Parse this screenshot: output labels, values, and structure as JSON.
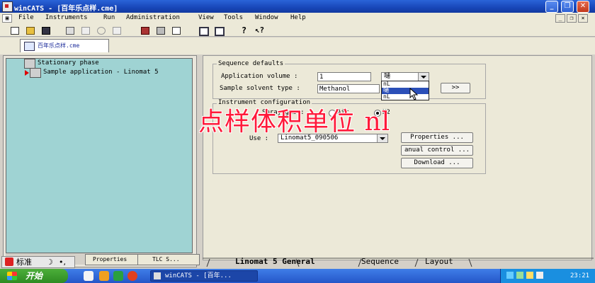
{
  "window": {
    "title": "winCATS - [百年乐点样.cme]",
    "minimize": "_",
    "restore": "❐",
    "close": "✕"
  },
  "menu": [
    "File",
    "Instruments",
    "Run",
    "Administration",
    "View",
    "Tools",
    "Window",
    "Help"
  ],
  "toolbar": {
    "icons": [
      "new-icon",
      "open-icon",
      "save-icon",
      "copy-doc-icon",
      "paste-doc-icon",
      "refresh-icon",
      "report-icon",
      "instrument-icon",
      "print-icon",
      "print-preview-icon",
      "window-icon",
      "layout-icon",
      "help-icon",
      "context-help-icon"
    ]
  },
  "doc_tab": {
    "label": "百年乐点样.cme"
  },
  "tree": {
    "items": [
      {
        "label": "Stationary phase"
      },
      {
        "label": "Sample application - Linomat 5"
      }
    ]
  },
  "left_tabs": [
    "Properties",
    "TLC S..."
  ],
  "sequence_defaults": {
    "title": "Sequence defaults",
    "application_volume_label": "Application volume :",
    "application_volume_value": "1",
    "unit_selected": "嗵",
    "unit_options": [
      "nL",
      "嗵",
      "nL"
    ],
    "solvent_label": "Sample solvent type :",
    "solvent_value": "Methanol",
    "more_button": ">>"
  },
  "instrument_config": {
    "title": "Instrument configuration",
    "spray_gas_label": "Spray gas :",
    "air_label": "Air",
    "n2_label": "N2",
    "use_label": "Use :",
    "use_value": "Linomat5_090506",
    "properties_button": "Properties ...",
    "manual_button": "anual control ...",
    "download_button": "Download ..."
  },
  "overlay_caption": "点样体积单位 nl",
  "bottom_tabs": [
    "Linomat 5 General",
    "Sequence",
    "Layout"
  ],
  "taskbar": {
    "start": "开始",
    "task": "winCATS - [百年...",
    "clock": "23:21",
    "ime": "标准"
  }
}
